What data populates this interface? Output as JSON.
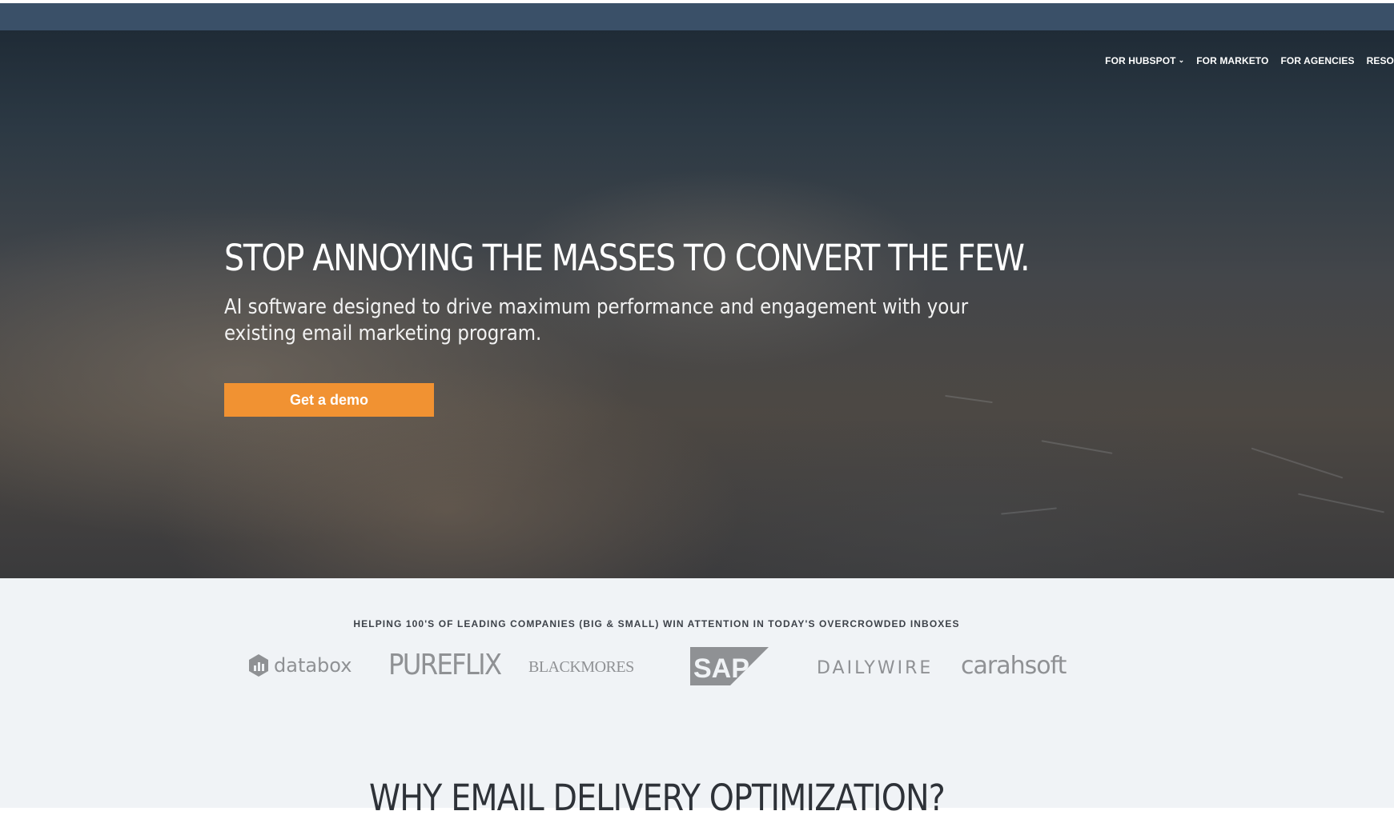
{
  "nav": {
    "items": [
      {
        "label": "FOR HUBSPOT",
        "has_dropdown": true
      },
      {
        "label": "FOR MARKETO"
      },
      {
        "label": "FOR AGENCIES"
      },
      {
        "label": "RESO"
      }
    ]
  },
  "hero": {
    "title": "STOP ANNOYING THE MASSES TO CONVERT THE FEW.",
    "subtitle": "AI software designed to drive maximum performance and engagement with your existing email marketing program.",
    "cta_label": "Get a demo"
  },
  "logos": {
    "tagline": "HELPING 100'S OF LEADING COMPANIES (BIG & SMALL) WIN ATTENTION IN TODAY'S OVERCROWDED INBOXES",
    "items": [
      "databox",
      "PUREFLIX",
      "BLACKMORES",
      "SAP",
      "DAILYWIRE",
      "carahsoft"
    ]
  },
  "section": {
    "heading": "WHY EMAIL DELIVERY OPTIMIZATION?"
  },
  "colors": {
    "topbar": "#3a5068",
    "accent": "#f19232",
    "logo_gray": "#8f9194",
    "section_bg": "#f0f3f6"
  }
}
